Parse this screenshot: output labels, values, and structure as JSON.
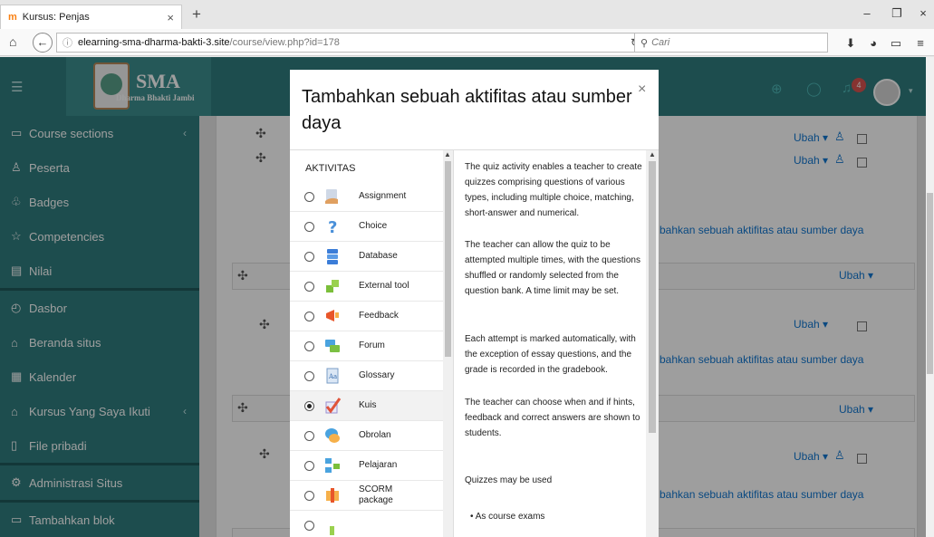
{
  "browser": {
    "tab_title": "Kursus: Penjas",
    "tab_close": "×",
    "new_tab": "+",
    "favicon": "m",
    "url_host": "elearning-sma-dharma-bakti-3.site",
    "url_path": "/course/view.php?id=178",
    "search_placeholder": "Cari",
    "window_controls": [
      "–",
      "❐",
      "×"
    ]
  },
  "navbar": {
    "brand": "SMA",
    "brand_sub": "Dharma Bhakti Jambi",
    "notification_count": "4"
  },
  "sidebar": {
    "items": [
      {
        "label": "Course sections",
        "icon": "folder-icon"
      },
      {
        "label": "Peserta",
        "icon": "users-icon"
      },
      {
        "label": "Badges",
        "icon": "badge-icon"
      },
      {
        "label": "Competencies",
        "icon": "star-icon"
      },
      {
        "label": "Nilai",
        "icon": "grades-icon"
      },
      {
        "label": "Dasbor",
        "icon": "dashboard-icon"
      },
      {
        "label": "Beranda situs",
        "icon": "home-icon"
      },
      {
        "label": "Kalender",
        "icon": "calendar-icon"
      },
      {
        "label": "Kursus Yang Saya Ikuti",
        "icon": "graduation-icon"
      },
      {
        "label": "File pribadi",
        "icon": "file-icon"
      },
      {
        "label": "Administrasi Situs",
        "icon": "gear-icon"
      },
      {
        "label": "Tambahkan blok",
        "icon": "block-icon"
      }
    ]
  },
  "main": {
    "edit_label": "Ubah ▾",
    "add_activity_label": "bahkan sebuah aktifitas atau sumber daya"
  },
  "modal": {
    "title": "Tambahkan sebuah aktifitas atau sumber daya",
    "close": "×",
    "section_header": "AKTIVITAS",
    "options": [
      {
        "label": "Assignment",
        "icon": "assignment-icon",
        "selected": false
      },
      {
        "label": "Choice",
        "icon": "choice-icon",
        "selected": false
      },
      {
        "label": "Database",
        "icon": "database-icon",
        "selected": false
      },
      {
        "label": "External tool",
        "icon": "external-tool-icon",
        "selected": false
      },
      {
        "label": "Feedback",
        "icon": "feedback-icon",
        "selected": false
      },
      {
        "label": "Forum",
        "icon": "forum-icon",
        "selected": false
      },
      {
        "label": "Glossary",
        "icon": "glossary-icon",
        "selected": false
      },
      {
        "label": "Kuis",
        "icon": "quiz-icon",
        "selected": true
      },
      {
        "label": "Obrolan",
        "icon": "chat-icon",
        "selected": false
      },
      {
        "label": "Pelajaran",
        "icon": "lesson-icon",
        "selected": false
      },
      {
        "label": "SCORM package",
        "icon": "scorm-icon",
        "selected": false
      }
    ],
    "help": [
      "The quiz activity enables a teacher to create quizzes comprising questions of various types, including multiple choice, matching, short-answer and numerical.",
      "The teacher can allow the quiz to be attempted multiple times, with the questions shuffled or randomly selected from the question bank. A time limit may be set.",
      "Each attempt is marked automatically, with the exception of essay questions, and the grade is recorded in the gradebook.",
      "The teacher can choose when and if hints, feedback and correct answers are shown to students.",
      "Quizzes may be used",
      "• As course exams"
    ]
  },
  "colors": {
    "brand_teal": "#2f7d7e",
    "link_blue": "#1177d1",
    "badge_red": "#d9534f"
  }
}
